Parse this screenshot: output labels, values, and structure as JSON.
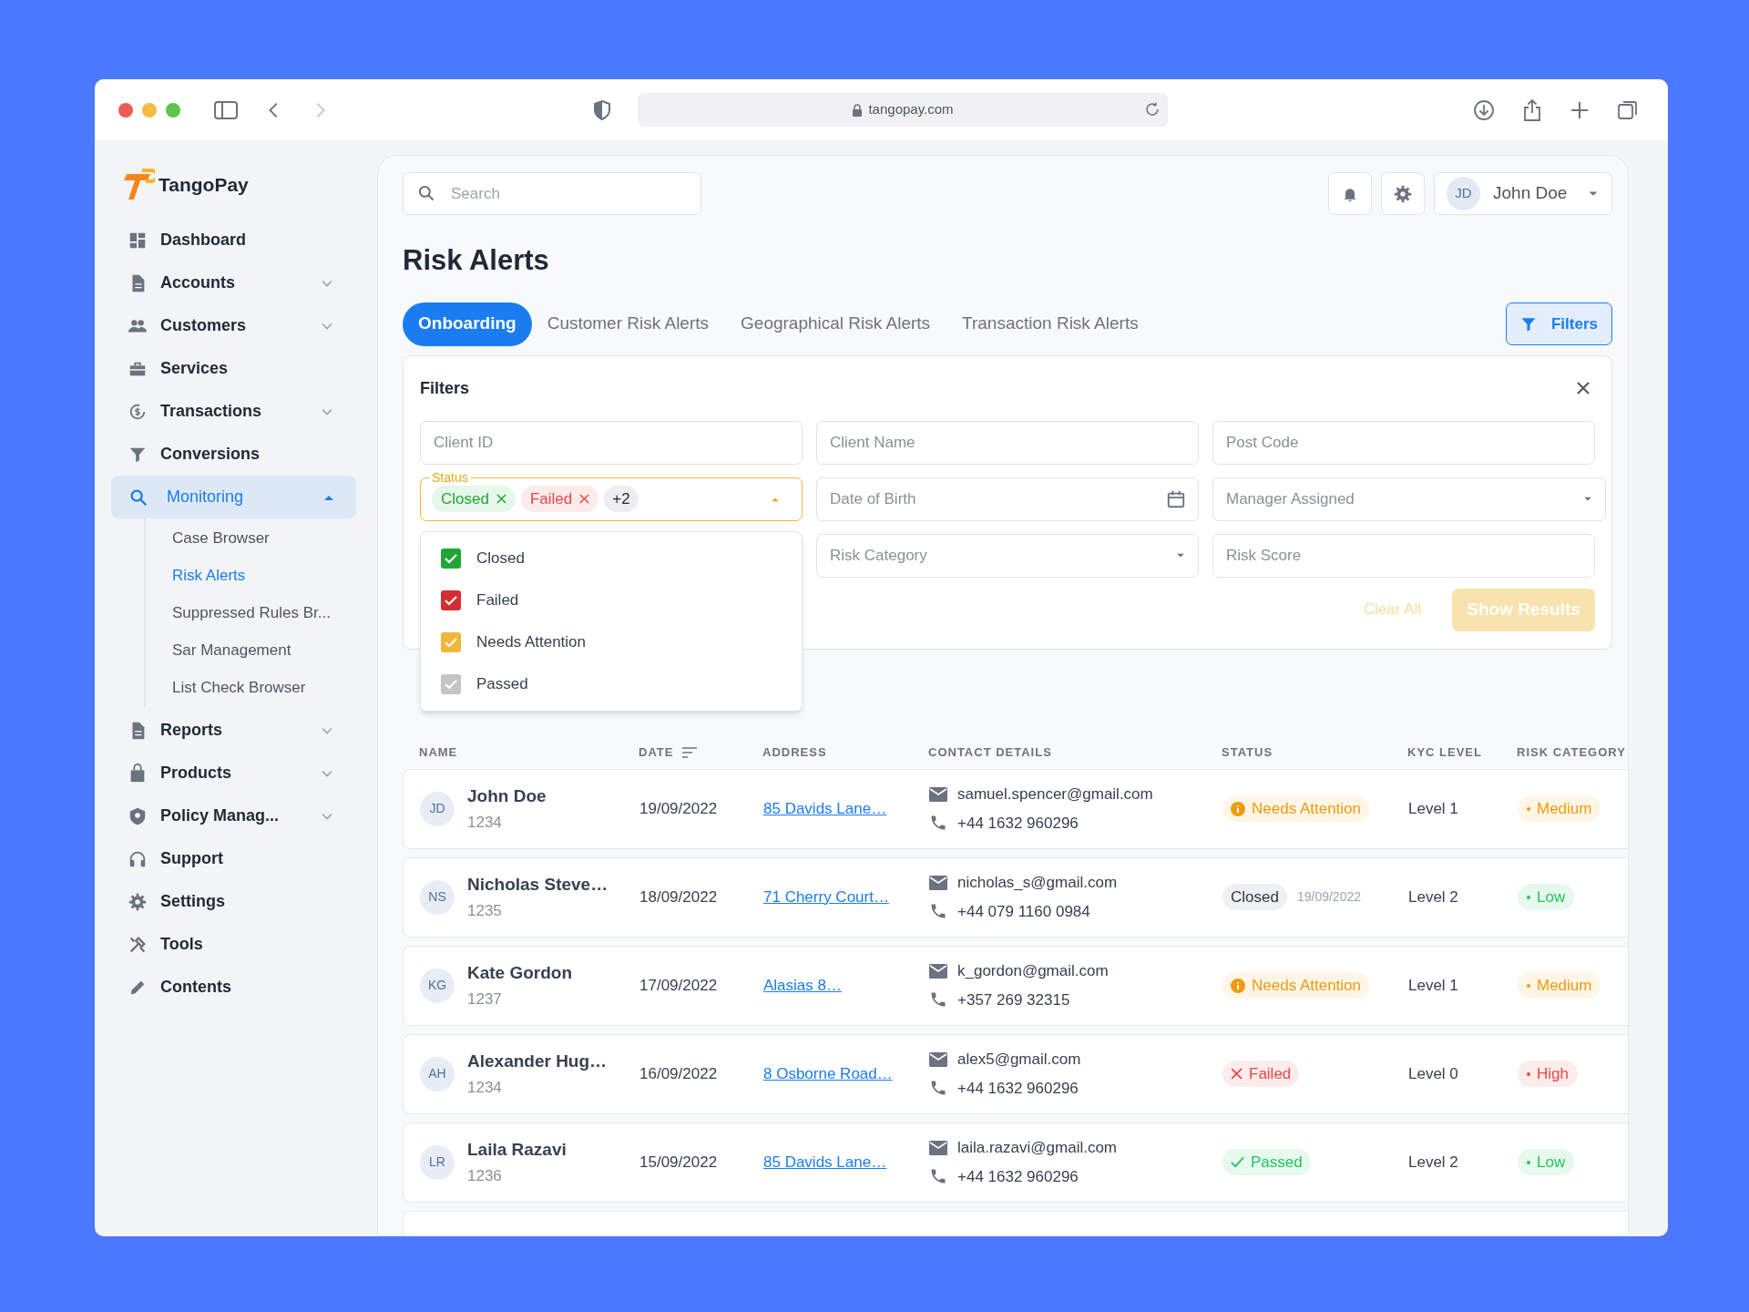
{
  "browser": {
    "address": "tangopay.com"
  },
  "sidebar": {
    "logo": "TangoPay",
    "items": [
      {
        "label": "Dashboard",
        "kind": "link",
        "selected": false
      },
      {
        "label": "Accounts",
        "kind": "group",
        "expanded": false,
        "selected": false
      },
      {
        "label": "Customers",
        "kind": "group",
        "expanded": false,
        "selected": false
      },
      {
        "label": "Services",
        "kind": "link",
        "selected": false
      },
      {
        "label": "Transactions",
        "kind": "group",
        "expanded": false,
        "selected": false
      },
      {
        "label": "Conversions",
        "kind": "link",
        "selected": false
      },
      {
        "label": "Monitoring",
        "kind": "group",
        "expanded": true,
        "selected": true,
        "children": [
          {
            "label": "Case Browser",
            "selected": false
          },
          {
            "label": "Risk Alerts",
            "selected": true
          },
          {
            "label": "Suppressed Rules Br...",
            "selected": false
          },
          {
            "label": "Sar Management",
            "selected": false
          },
          {
            "label": "List Check Browser",
            "selected": false
          }
        ]
      },
      {
        "label": "Reports",
        "kind": "group",
        "expanded": false,
        "selected": false
      },
      {
        "label": "Products",
        "kind": "group",
        "expanded": false,
        "selected": false
      },
      {
        "label": "Policy Manag...",
        "kind": "group",
        "expanded": false,
        "selected": false
      },
      {
        "label": "Support",
        "kind": "link",
        "selected": false
      },
      {
        "label": "Settings",
        "kind": "link",
        "selected": false
      },
      {
        "label": "Tools",
        "kind": "link",
        "selected": false
      },
      {
        "label": "Contents",
        "kind": "link",
        "selected": false
      }
    ]
  },
  "header": {
    "search": {
      "placeholder": "Search"
    },
    "user": {
      "initials": "JD",
      "name": "John Doe"
    }
  },
  "page_title": "Risk Alerts",
  "tabs": [
    {
      "label": "Onboarding",
      "selected": true
    },
    {
      "label": "Customer Risk Alerts",
      "selected": false
    },
    {
      "label": "Geographical Risk Alerts",
      "selected": false
    },
    {
      "label": "Transaction Risk Alerts",
      "selected": false
    }
  ],
  "filters_button": "Filters",
  "filters": {
    "title": "Filters",
    "client_id": {
      "placeholder": "Client ID"
    },
    "client_name": {
      "placeholder": "Client Name"
    },
    "post_code": {
      "placeholder": "Post Code"
    },
    "status": {
      "label": "Status",
      "chips": [
        {
          "label": "Closed",
          "kind": "closed"
        },
        {
          "label": "Failed",
          "kind": "failed"
        }
      ],
      "more": "+2",
      "options": [
        {
          "label": "Closed",
          "checked": true,
          "color": "#22a535"
        },
        {
          "label": "Failed",
          "checked": true,
          "color": "#d32f2f"
        },
        {
          "label": "Needs Attention",
          "checked": true,
          "color": "#f0b83a"
        },
        {
          "label": "Passed",
          "checked": true,
          "color": "#c4c4c4"
        }
      ]
    },
    "date_of_birth": {
      "placeholder": "Date of Birth"
    },
    "manager": {
      "placeholder": "Manager Assigned"
    },
    "risk_category": {
      "placeholder": "Risk Category"
    },
    "risk_score": {
      "placeholder": "Risk Score"
    },
    "clear_all": "Clear All",
    "show_results": "Show Results"
  },
  "table": {
    "columns": [
      "NAME",
      "DATE",
      "ADDRESS",
      "CONTACT DETAILS",
      "STATUS",
      "KYC LEVEL",
      "RISK CATEGORY"
    ],
    "rows": [
      {
        "initials": "JD",
        "name": "John Doe",
        "id": "1234",
        "date": "19/09/2022",
        "address": "85 Davids Lane…",
        "email": "samuel.spencer@gmail.com",
        "phone": "+44 1632 960296",
        "status": {
          "kind": "attention",
          "label": "Needs Attention"
        },
        "kyc": "Level 1",
        "risk": {
          "kind": "medium",
          "label": "Medium"
        }
      },
      {
        "initials": "NS",
        "name": "Nicholas Steve…",
        "id": "1235",
        "date": "18/09/2022",
        "address": "71 Cherry Court…",
        "email": "nicholas_s@gmail.com",
        "phone": "+44 079 1160 0984",
        "status": {
          "kind": "closed",
          "label": "Closed",
          "date": "19/09/2022"
        },
        "kyc": "Level 2",
        "risk": {
          "kind": "low",
          "label": "Low"
        }
      },
      {
        "initials": "KG",
        "name": "Kate Gordon",
        "id": "1237",
        "date": "17/09/2022",
        "address": "Alasias 8…",
        "email": "k_gordon@gmail.com",
        "phone": "+357 269 32315",
        "status": {
          "kind": "attention",
          "label": "Needs Attention"
        },
        "kyc": "Level 1",
        "risk": {
          "kind": "medium",
          "label": "Medium"
        }
      },
      {
        "initials": "AH",
        "name": "Alexander Hug…",
        "id": "1234",
        "date": "16/09/2022",
        "address": "8 Osborne Road…",
        "email": "alex5@gmail.com",
        "phone": "+44 1632 960296",
        "status": {
          "kind": "failed",
          "label": "Failed"
        },
        "kyc": "Level 0",
        "risk": {
          "kind": "high",
          "label": "High"
        }
      },
      {
        "initials": "LR",
        "name": "Laila Razavi",
        "id": "1236",
        "date": "15/09/2022",
        "address": "85 Davids Lane…",
        "email": "laila.razavi@gmail.com",
        "phone": "+44 1632 960296",
        "status": {
          "kind": "passed",
          "label": "Passed"
        },
        "kyc": "Level 2",
        "risk": {
          "kind": "low",
          "label": "Low"
        }
      }
    ]
  }
}
